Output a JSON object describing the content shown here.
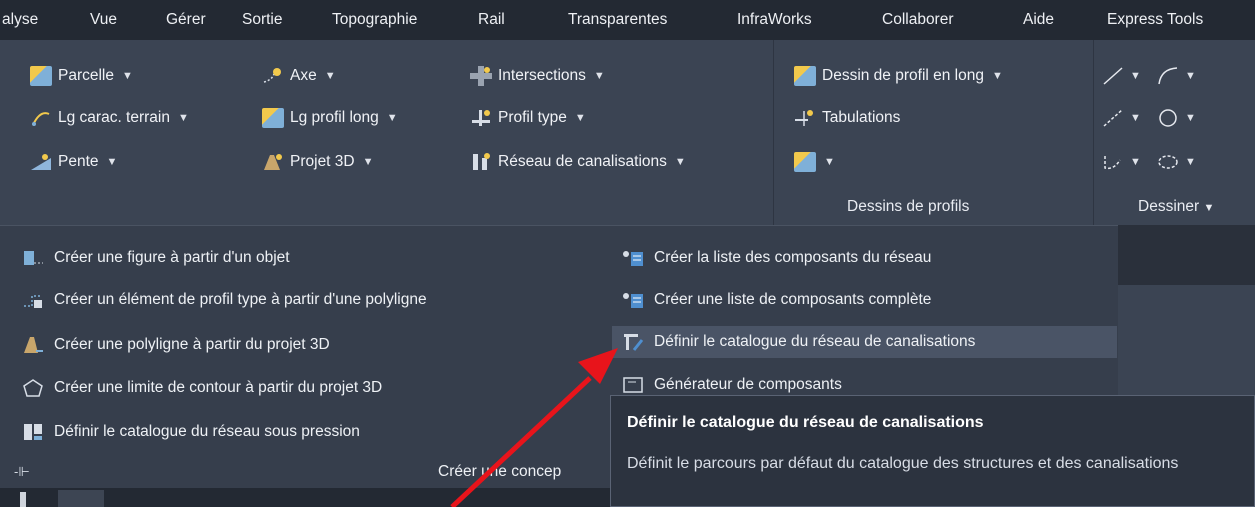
{
  "menu": [
    "alyse",
    "Vue",
    "Gérer",
    "Sortie",
    "Topographie",
    "Rail",
    "Transparentes",
    "InfraWorks",
    "Collaborer",
    "Aide",
    "Express Tools"
  ],
  "ribbon": {
    "col1": [
      "Parcelle",
      "Lg carac. terrain",
      "Pente"
    ],
    "col2": [
      "Axe",
      "Lg profil long",
      "Projet 3D"
    ],
    "col3": [
      "Intersections",
      "Profil type",
      "Réseau de canalisations"
    ],
    "profils": {
      "items": [
        "Dessin de profil en long",
        "Tabulations",
        ""
      ],
      "title": "Dessins de profils"
    },
    "dessiner_title": "Dessiner"
  },
  "dropdown": {
    "left_items": [
      "Créer une figure à partir d'un objet",
      "Créer un élément de profil type à partir d'une polyligne",
      "Créer une polyligne à partir du projet 3D",
      "Créer une limite de contour à partir du projet 3D",
      "Définir le catalogue du réseau sous pression"
    ],
    "right_items": [
      "Créer la liste des composants du réseau",
      "Créer une liste de composants complète",
      "Définir le catalogue du réseau de canalisations",
      "Générateur de composants"
    ],
    "footer": "Créer une concep"
  },
  "tooltip": {
    "title": "Définir le catalogue du réseau de canalisations",
    "desc": "Définit le parcours par défaut du catalogue des structures et des canalisations"
  },
  "colors": {
    "arrow": "#e8141b",
    "tooltip_bg": "#2c333f",
    "ribbon_bg": "#3b4453",
    "menu_bg": "#232933"
  }
}
